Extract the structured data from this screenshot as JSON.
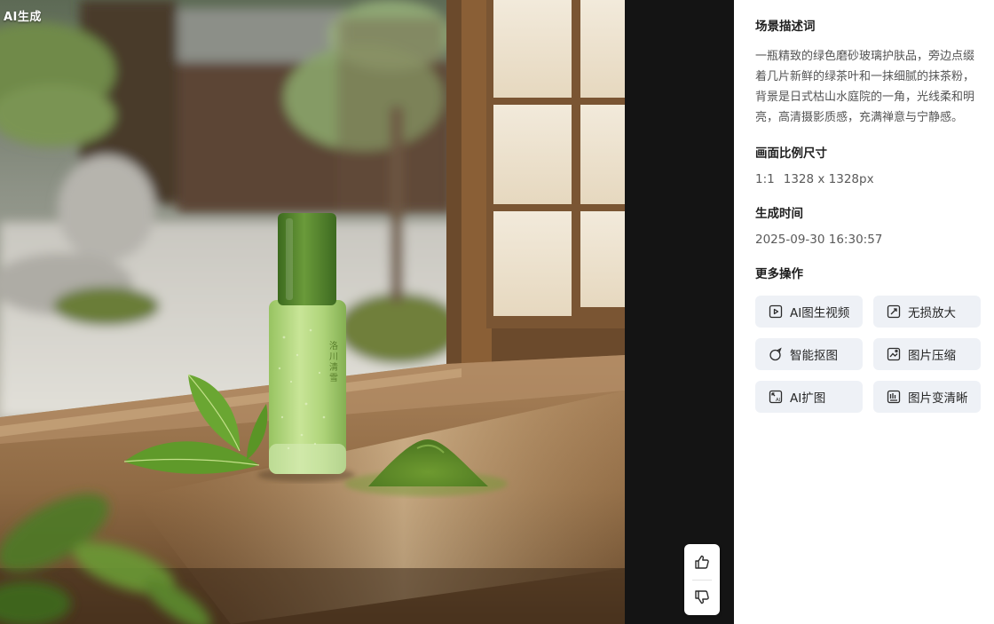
{
  "image": {
    "badge": "AI生成",
    "bottle_label": "洛川清雪"
  },
  "feedback": {
    "like_icon": "thumbs-up-icon",
    "dislike_icon": "thumbs-down-icon"
  },
  "panel": {
    "scene": {
      "title": "场景描述词",
      "text": "一瓶精致的绿色磨砂玻璃护肤品，旁边点缀着几片新鲜的绿茶叶和一抹细腻的抹茶粉，背景是日式枯山水庭院的一角，光线柔和明亮，高清摄影质感，充满禅意与宁静感。"
    },
    "ratio": {
      "title": "画面比例尺寸",
      "ratio": "1:1",
      "size": "1328 x 1328px"
    },
    "time": {
      "title": "生成时间",
      "value": "2025-09-30 16:30:57"
    },
    "more": {
      "title": "更多操作",
      "actions": [
        {
          "label": "AI图生视频",
          "icon": "image-to-video-icon"
        },
        {
          "label": "无损放大",
          "icon": "upscale-icon"
        },
        {
          "label": "智能抠图",
          "icon": "cutout-icon"
        },
        {
          "label": "图片压缩",
          "icon": "compress-icon"
        },
        {
          "label": "AI扩图",
          "icon": "expand-image-icon"
        },
        {
          "label": "图片变清晰",
          "icon": "sharpen-icon"
        }
      ]
    }
  },
  "colors": {
    "viewer_bg": "#141414",
    "action_bg": "#eef1f6",
    "matcha_green": "#5d8a2e"
  }
}
